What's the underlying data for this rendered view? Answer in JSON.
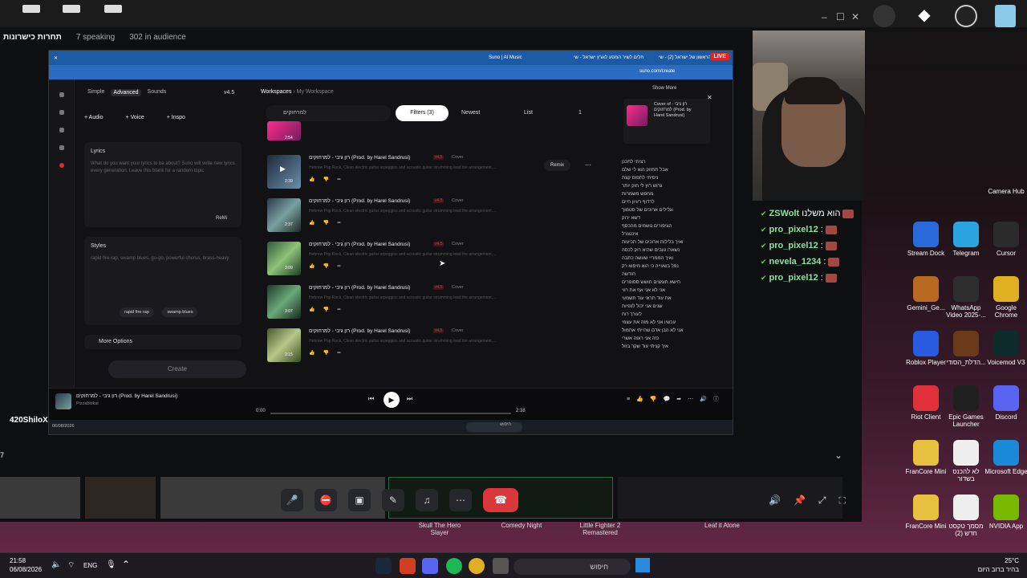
{
  "stage": {
    "title": "תחרות כישרונות",
    "speaking": "7 speaking",
    "audience": "302 in audience",
    "streamer": "420ShiloX",
    "side_number": "7"
  },
  "browser": {
    "live_badge": "LIVE",
    "tabs": [
      "Suno | AI Music",
      "חלים לשיר המסע לארץ ישראל - שי",
      "השיר הראשון של ישראל (2) - שי"
    ],
    "url": "suno.com/create"
  },
  "suno": {
    "modes": [
      "Simple",
      "Advanced",
      "Sounds"
    ],
    "version": "v4.5",
    "add_buttons": [
      "+ Audio",
      "+ Voice",
      "+ Inspo"
    ],
    "lyrics_title": "Lyrics",
    "lyrics_placeholder": "What do you want your lyrics to be about? Suno will write new lyrics every generation. Leave this blank for a random topic",
    "refill": "ReMi",
    "styles_title": "Styles",
    "styles_text": "rapid fire rap, swamp blues, go-go, powerful chorus, brass-heavy",
    "style_chips": [
      "rapid fire rap",
      "swamp blues"
    ],
    "more_options": "More Options",
    "create_label": "Create",
    "breadcrumb_root": "Workspaces",
    "breadcrumb_current": "My Workspace",
    "search_value": "למרחוקים",
    "filter_label": "Filters (3)",
    "sort_label": "Newest",
    "view_label": "List",
    "page": "1",
    "remix": "Remix",
    "songs": [
      {
        "title": "רון גיבי - למרחוקים (Prod. by Harel Sandrusi)",
        "duration": "2:39",
        "version": "v4.5",
        "kind": "Cover",
        "desc": "Hebrew Pop Rock, Clean electric guitar arpeggios and acoustic guitar strumming lead the arrangement,..."
      },
      {
        "title": "רון גיבי - למרחוקים (Prod. by Harel Sandrusi)",
        "duration": "2:37",
        "version": "v4.5",
        "kind": "Cover",
        "desc": "Hebrew Pop Rock, Clean electric guitar arpeggios and acoustic guitar strumming lead the arrangement,..."
      },
      {
        "title": "רון גיבי - למרחוקים (Prod. by Harel Sandrusi)",
        "duration": "3:09",
        "version": "v4.5",
        "kind": "Cover",
        "desc": "Hebrew Pop Rock, Clean electric guitar arpeggios and acoustic guitar strumming lead the arrangement,..."
      },
      {
        "title": "רון גיבי - למרחוקים (Prod. by Harel Sandrusi)",
        "duration": "3:07",
        "version": "v4.5",
        "kind": "Cover",
        "desc": "Hebrew Pop Rock, Clean electric guitar arpeggios and acoustic guitar strumming lead the arrangement,..."
      },
      {
        "title": "רון גיבי - למרחוקים (Prod. by Harel Sandrusi)",
        "duration": "3:15",
        "version": "v4.5",
        "kind": "Cover",
        "desc": "Hebrew Pop Rock, Clean electric guitar arpeggios and acoustic guitar strumming lead the arrangement,..."
      }
    ],
    "first_duration": "2:54",
    "detail_show_more": "Show More",
    "detail_card": "Cover of רון גיבי - למרחוקים (Prod. by Harel Sandrusi)",
    "lyrics_lines": [
      "רציתי לתכנן",
      "אבל תחזוק הוא לי שלם",
      "ניסיתי לתפוס קצת",
      "גרוש רוץ לי חוק יותר",
      "מחפש משמרות",
      "לרדוף רעיון חיים",
      "וגלילים ארוכים של סטמוך",
      "דשא ירוק",
      "הציפורים נושמים מהכסף",
      "אינטגרל",
      "ואיך בלילות ארוכים של תכיעות",
      "נשארו טובים שהיא רוק לכסה",
      "ואיך הממריי שעשה כתבה",
      "נפל בשעייה כי הוא מיפוא רק",
      "חודשה",
      "חישא חומצים חושש ססופרים",
      "אני לא אני אף את רווי",
      "את עוד תראי עוד תשמעי",
      "שנים אני יכול לנפיות",
      "לעורך רוח",
      "עכשיו אני לא מזה את עצמי",
      "אני לא הבן אדם שהייתי אתמול",
      "כזה אני רופה אשרי",
      "איך קניתי עוד שקר בזול"
    ],
    "player_title": "רון גיבי - למרחוקים (Prod. by Harel Sandrusi)",
    "player_artist": "Pizzabiskat",
    "time_current": "0:00",
    "time_total": "2:38",
    "progress": 0.0
  },
  "chat": [
    {
      "name": "ZSWolt",
      "msg": "הוא משלנו"
    },
    {
      "name": "pro_pixel12",
      "msg": ":"
    },
    {
      "name": "pro_pixel12",
      "msg": ":"
    },
    {
      "name": "nevela_1234",
      "msg": ":"
    },
    {
      "name": "pro_pixel12",
      "msg": ":"
    }
  ],
  "desktop_icons": [
    {
      "label": "Camera Hub",
      "color": "#6a6a6a"
    },
    {
      "label": "Stream Dock",
      "color": "#2a6ad8"
    },
    {
      "label": "Telegram",
      "color": "#2aa3e0"
    },
    {
      "label": "Cursor",
      "color": "#2b2b2b"
    },
    {
      "label": "Gemini_Ge...",
      "color": "#b86a20"
    },
    {
      "label": "WhatsApp Video 2025-...",
      "color": "#2e2e2e"
    },
    {
      "label": "Google Chrome",
      "color": "#e0b020"
    },
    {
      "label": "Roblox Player",
      "color": "#2a5ae0"
    },
    {
      "label": "הדלת_הסודי...",
      "color": "#6a3a1a"
    },
    {
      "label": "Voicemod V3",
      "color": "#0d2b2a"
    },
    {
      "label": "Riot Client",
      "color": "#e0303a"
    },
    {
      "label": "Epic Games Launcher",
      "color": "#202020"
    },
    {
      "label": "Discord",
      "color": "#5865f2"
    },
    {
      "label": "FranCore Mini",
      "color": "#e8c040"
    },
    {
      "label": "לא להכנס בשדור",
      "color": "#eeeeee"
    },
    {
      "label": "Microsoft Edge",
      "color": "#1a8ad8"
    },
    {
      "label": "FranCore Mini",
      "color": "#e8c040"
    },
    {
      "label": "מסמך טקסט חדש (2)",
      "color": "#eeeeee"
    },
    {
      "label": "NVIDIA App",
      "color": "#76b900"
    }
  ],
  "games_strip": [
    "Skull The Hero Slayer",
    "Comedy Night",
    "Little Fighter 2 Remastered",
    "Leaf it Alone"
  ],
  "taskbar": {
    "time": "21:58",
    "date": "06/08/2026",
    "lang": "ENG",
    "search": "חיפוש",
    "weather_temp": "25°C",
    "weather_desc": "בהיר ברוב היום"
  }
}
